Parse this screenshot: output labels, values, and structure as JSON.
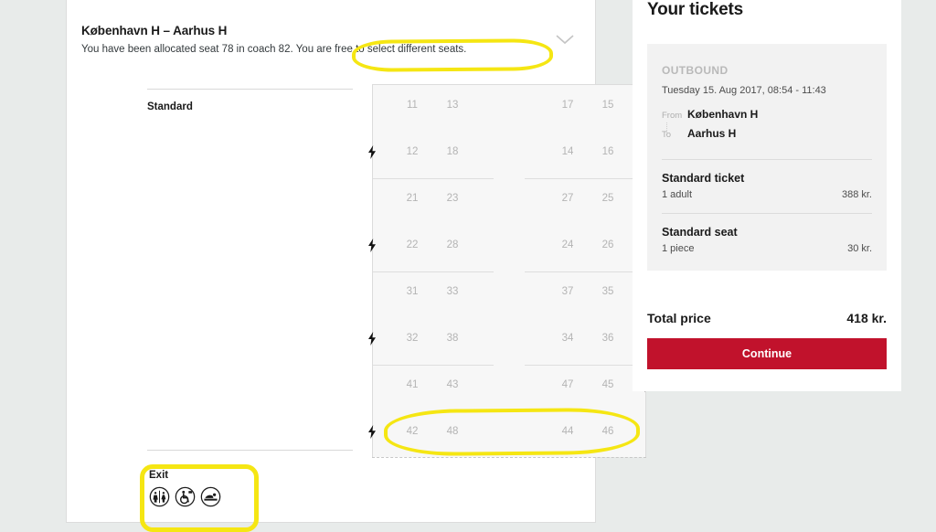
{
  "journey": {
    "title": "København H – Aarhus H",
    "allocation_text": "You have been allocated seat 78 in coach 82.",
    "free_seats_text": "You are free to select different seats.",
    "collapse_icon": "chevron-down-icon"
  },
  "seatmap": {
    "class_label": "Standard",
    "exit_label": "Exit",
    "facilities": [
      {
        "icon": "toilet-icon"
      },
      {
        "icon": "wheelchair-accessible-icon"
      },
      {
        "icon": "baby-changing-icon"
      }
    ],
    "blocks": [
      {
        "row_a": {
          "seats": [
            "11",
            "13",
            "17",
            "15"
          ],
          "bolt_left": false,
          "bolt_right": true
        },
        "row_b": {
          "seats": [
            "12",
            "18",
            "14",
            "16"
          ],
          "bolt_left": true,
          "bolt_right": false
        }
      },
      {
        "row_a": {
          "seats": [
            "21",
            "23",
            "27",
            "25"
          ],
          "bolt_left": false,
          "bolt_right": true
        },
        "row_b": {
          "seats": [
            "22",
            "28",
            "24",
            "26"
          ],
          "bolt_left": true,
          "bolt_right": false
        }
      },
      {
        "row_a": {
          "seats": [
            "31",
            "33",
            "37",
            "35"
          ],
          "bolt_left": false,
          "bolt_right": true
        },
        "row_b": {
          "seats": [
            "32",
            "38",
            "34",
            "36"
          ],
          "bolt_left": true,
          "bolt_right": false
        }
      },
      {
        "row_a": {
          "seats": [
            "41",
            "43",
            "47",
            "45"
          ],
          "bolt_left": false,
          "bolt_right": true
        },
        "row_b": {
          "seats": [
            "42",
            "48",
            "44",
            "46"
          ],
          "bolt_left": true,
          "bolt_right": false
        }
      }
    ]
  },
  "tickets": {
    "title": "Your tickets",
    "direction_label": "OUTBOUND",
    "datetime": "Tuesday 15. Aug 2017, 08:54 - 11:43",
    "from_tag": "From",
    "from_station": "København H",
    "to_tag": "To",
    "to_station": "Aarhus H",
    "items": [
      {
        "title": "Standard ticket",
        "detail": "1 adult",
        "price": "388 kr."
      },
      {
        "title": "Standard seat",
        "detail": "1 piece",
        "price": "30 kr."
      }
    ],
    "total_label": "Total price",
    "total_value": "418 kr.",
    "continue_label": "Continue"
  },
  "colors": {
    "highlight": "#f5e613",
    "accent_red": "#c1122c",
    "page_bg": "#e8ebea"
  }
}
